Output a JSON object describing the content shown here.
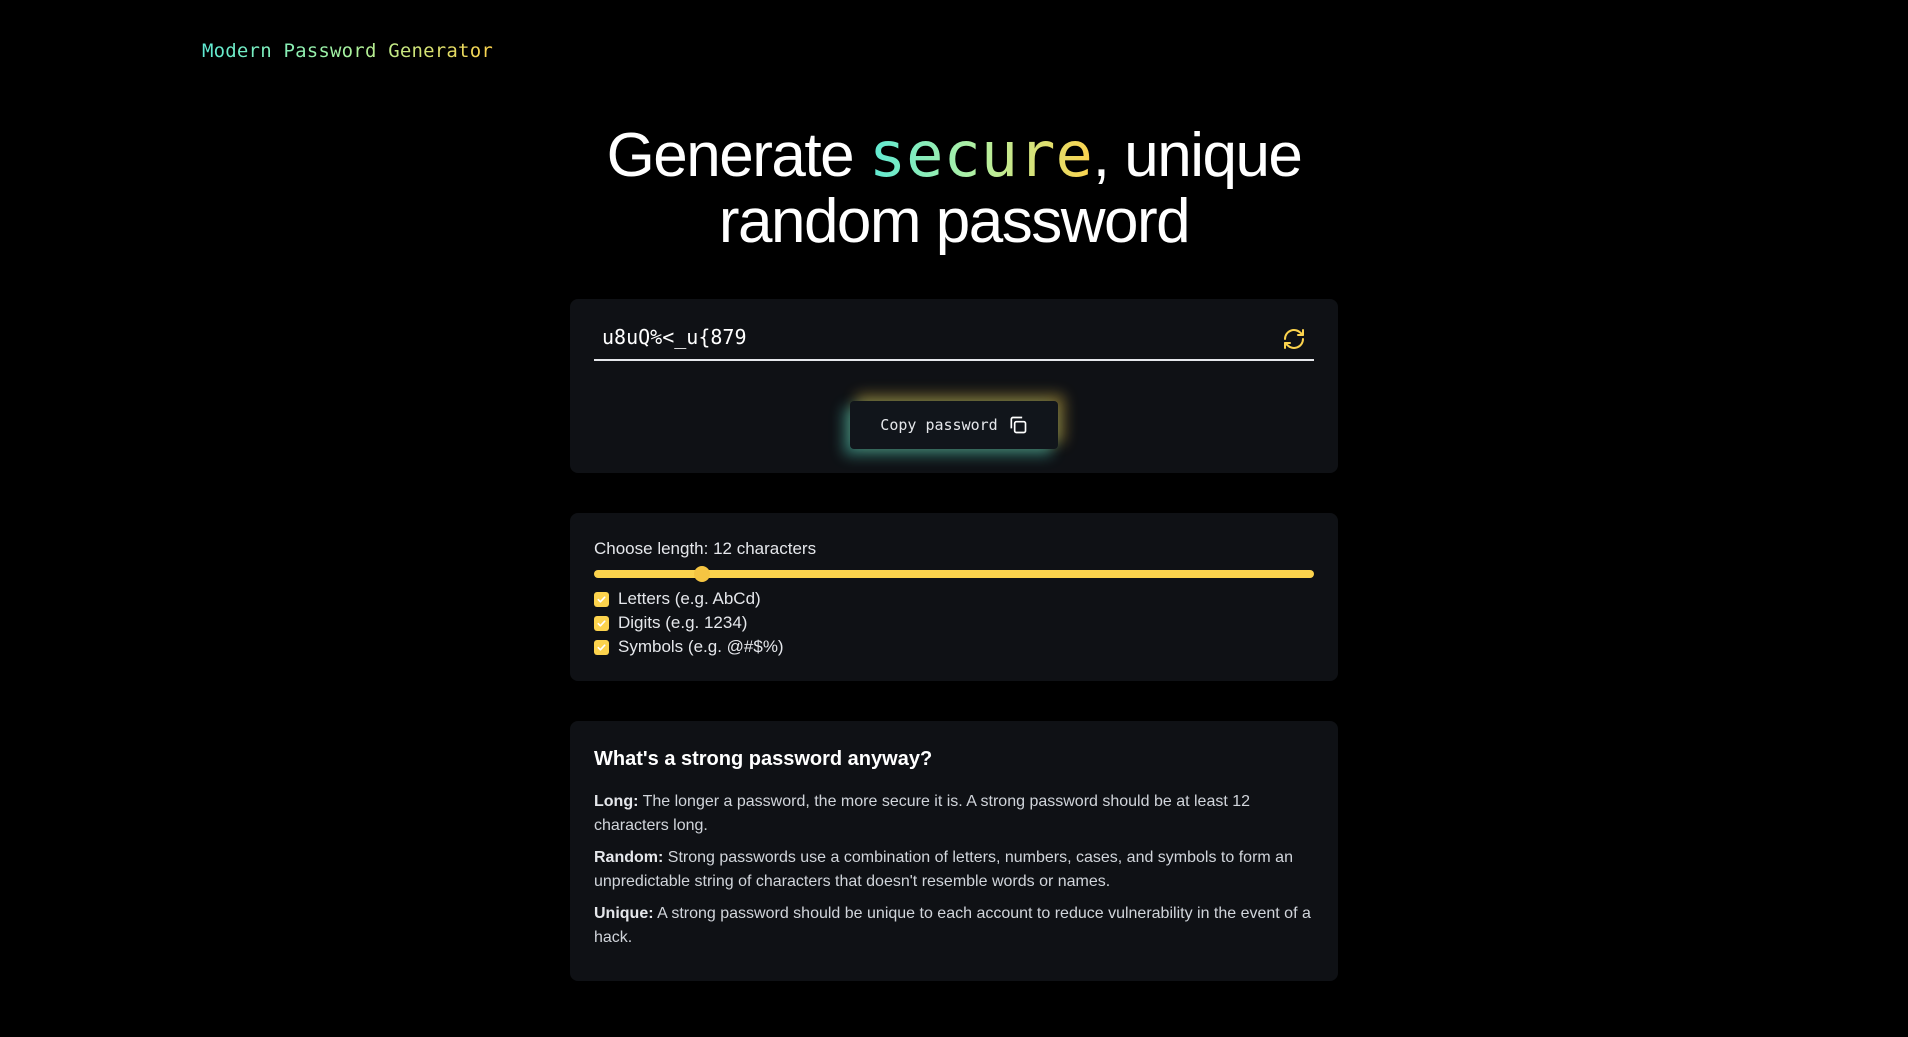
{
  "app": {
    "brand": "Modern Password Generator"
  },
  "hero": {
    "prefix": "Generate ",
    "accent": "secure",
    "suffix": ", unique",
    "line2": "random password"
  },
  "password": {
    "value": "u8uQ%<_u{879",
    "refresh_icon": "refresh-icon",
    "copy_label": "Copy password",
    "copy_icon": "copy-icon"
  },
  "options": {
    "length_label": "Choose length: 12 characters",
    "length_fraction": 0.15,
    "items": [
      {
        "label": "Letters (e.g. AbCd)",
        "checked": true
      },
      {
        "label": "Digits (e.g. 1234)",
        "checked": true
      },
      {
        "label": "Symbols (e.g. @#$%)",
        "checked": true
      }
    ]
  },
  "info": {
    "title": "What's a strong password anyway?",
    "items": [
      {
        "term": "Long:",
        "text": " The longer a password, the more secure it is. A strong password should be at least 12 characters long."
      },
      {
        "term": "Random:",
        "text": " Strong passwords use a combination of letters, numbers, cases, and symbols to form an unpredictable string of characters that doesn't resemble words or names."
      },
      {
        "term": "Unique:",
        "text": " A strong password should be unique to each account to reduce vulnerability in the event of a hack."
      }
    ]
  },
  "colors": {
    "accent_teal": "#5eead4",
    "accent_yellow": "#fcd34d",
    "card_bg": "#0f1115",
    "page_bg": "#000000"
  }
}
